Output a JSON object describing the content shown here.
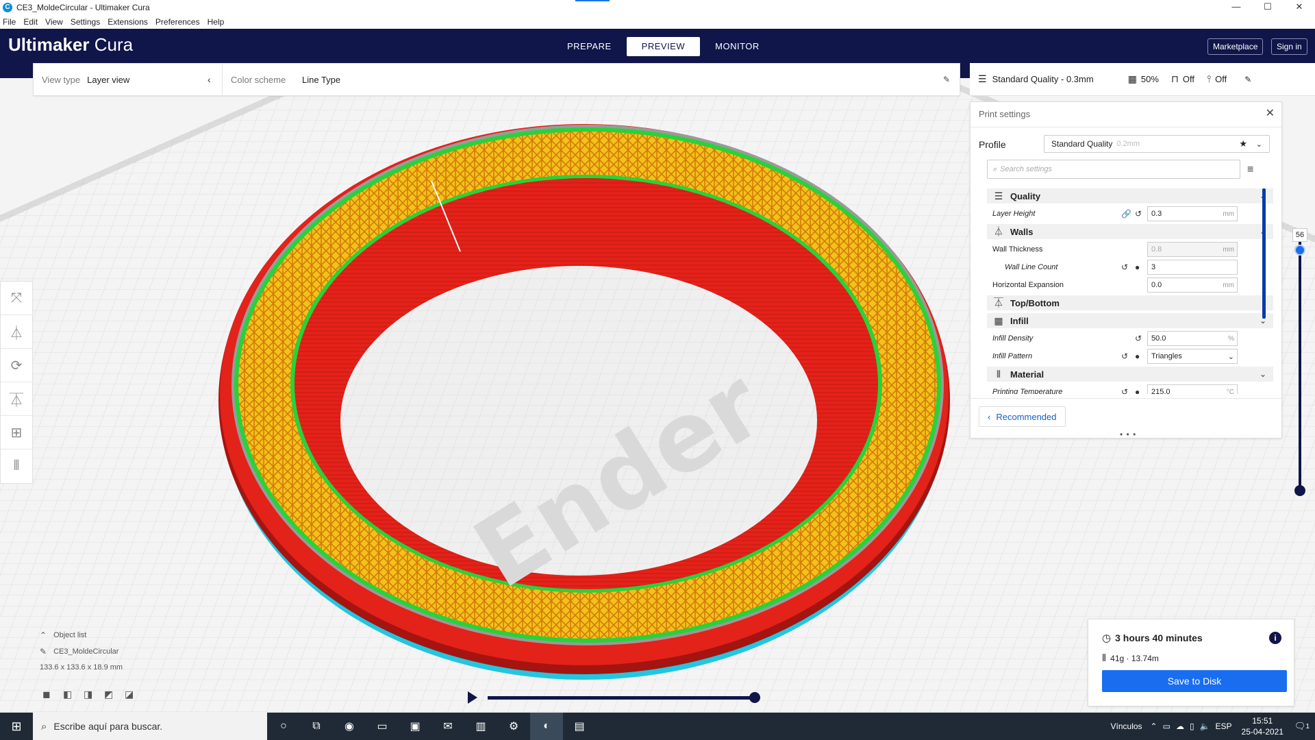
{
  "window": {
    "title": "CE3_MoldeCircular - Ultimaker Cura",
    "app_icon": "C",
    "controls": {
      "minimize": "—",
      "maximize": "☐",
      "close": "✕"
    }
  },
  "menu": [
    "File",
    "Edit",
    "View",
    "Settings",
    "Extensions",
    "Preferences",
    "Help"
  ],
  "header": {
    "brand_bold": "Ultimaker",
    "brand_light": "Cura",
    "stages": [
      "PREPARE",
      "PREVIEW",
      "MONITOR"
    ],
    "active_stage": "PREVIEW",
    "marketplace": "Marketplace",
    "sign_in": "Sign in"
  },
  "viewbar": {
    "view_type_label": "View type",
    "view_type_value": "Layer view",
    "color_scheme_label": "Color scheme",
    "color_scheme_value": "Line Type"
  },
  "quality_bar": {
    "profile": "Standard Quality - 0.3mm",
    "infill": "50%",
    "support": "Off",
    "adhesion": "Off"
  },
  "print_settings": {
    "title": "Print settings",
    "profile_label": "Profile",
    "profile_value": "Standard Quality",
    "profile_sub": "0.2mm",
    "search_placeholder": "Search settings",
    "categories": {
      "quality": "Quality",
      "walls": "Walls",
      "topbottom": "Top/Bottom",
      "infill": "Infill",
      "material": "Material"
    },
    "settings": {
      "layer_height": {
        "label": "Layer Height",
        "value": "0.3",
        "unit": "mm"
      },
      "wall_thickness": {
        "label": "Wall Thickness",
        "value": "0.8",
        "unit": "mm"
      },
      "wall_line_count": {
        "label": "Wall Line Count",
        "value": "3"
      },
      "horizontal_expansion": {
        "label": "Horizontal Expansion",
        "value": "0.0",
        "unit": "mm"
      },
      "infill_density": {
        "label": "Infill Density",
        "value": "50.0",
        "unit": "%"
      },
      "infill_pattern": {
        "label": "Infill Pattern",
        "value": "Triangles"
      },
      "printing_temperature": {
        "label": "Printing Temperature",
        "value": "215.0",
        "unit": "°C"
      }
    },
    "recommended_button": "Recommended"
  },
  "layer_slider": {
    "current_layer": "56"
  },
  "object_list": {
    "title": "Object list",
    "object_name": "CE3_MoldeCircular",
    "dimensions": "133.6 x 133.6 x 18.9 mm"
  },
  "bed_logo": "Ender",
  "estimate": {
    "time": "3 hours 40 minutes",
    "material": "41g · 13.74m",
    "save_button": "Save to Disk"
  },
  "taskbar": {
    "search_placeholder": "Escribe aquí para buscar.",
    "links_label": "Vínculos",
    "language": "ESP",
    "time": "15:51",
    "date": "25-04-2021",
    "notifications": "1"
  },
  "colors": {
    "header_bg": "#10154a",
    "accent_blue": "#196ef0",
    "infill_yellow": "#f5c518",
    "infill_orange": "#e88a0c",
    "wall_red": "#e8251a",
    "wall_green": "#28d23a",
    "support_cyan": "#20c8e0"
  }
}
